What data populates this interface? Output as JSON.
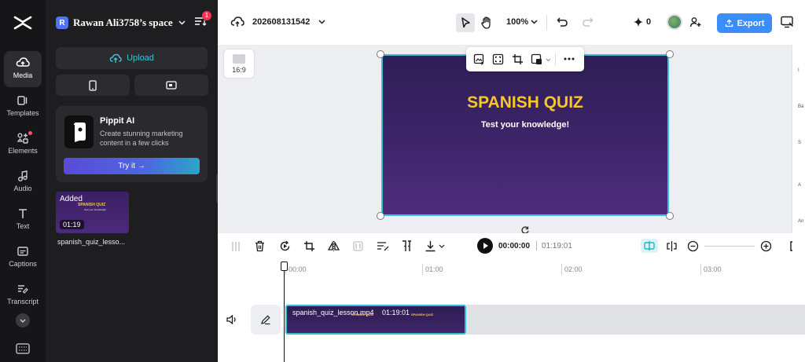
{
  "app": {
    "project_name": "202608131542"
  },
  "sidebar": {
    "items": [
      {
        "label": "Media"
      },
      {
        "label": "Templates"
      },
      {
        "label": "Elements"
      },
      {
        "label": "Audio"
      },
      {
        "label": "Text"
      },
      {
        "label": "Captions"
      },
      {
        "label": "Transcript"
      }
    ]
  },
  "panel": {
    "workspace_initial": "R",
    "workspace_name": "Rawan Ali3758’s space",
    "notification_count": "1",
    "upload_label": "Upload",
    "promo": {
      "title": "Pippit AI",
      "description": "Create stunning marketing content in a few clicks",
      "button": "Try it →"
    },
    "media": {
      "badge": "Added",
      "duration": "01:19",
      "filename": "spanish_quiz_lesso...",
      "thumb_title": "SPANISH QUIZ",
      "thumb_sub": "Test your knowledge!"
    }
  },
  "toolbar": {
    "zoom": "100%",
    "credits": "0",
    "export_label": "Export"
  },
  "canvas": {
    "ratio_label": "16:9",
    "title": "SPANISH QUIZ",
    "subtitle": "Test your knowledge!"
  },
  "timeline": {
    "current_time": "00:00:00",
    "total_time": "01:19:01",
    "ruler": [
      "00:00",
      "01:00",
      "02:00",
      "03:00"
    ],
    "clip_name": "spanish_quiz_lesson.mp4",
    "clip_duration": "01:19:01"
  },
  "colors": {
    "accent": "#37c0d8",
    "export": "#3b8dfc",
    "title_yellow": "#f7c72a",
    "video_purple": "#3c2468"
  }
}
